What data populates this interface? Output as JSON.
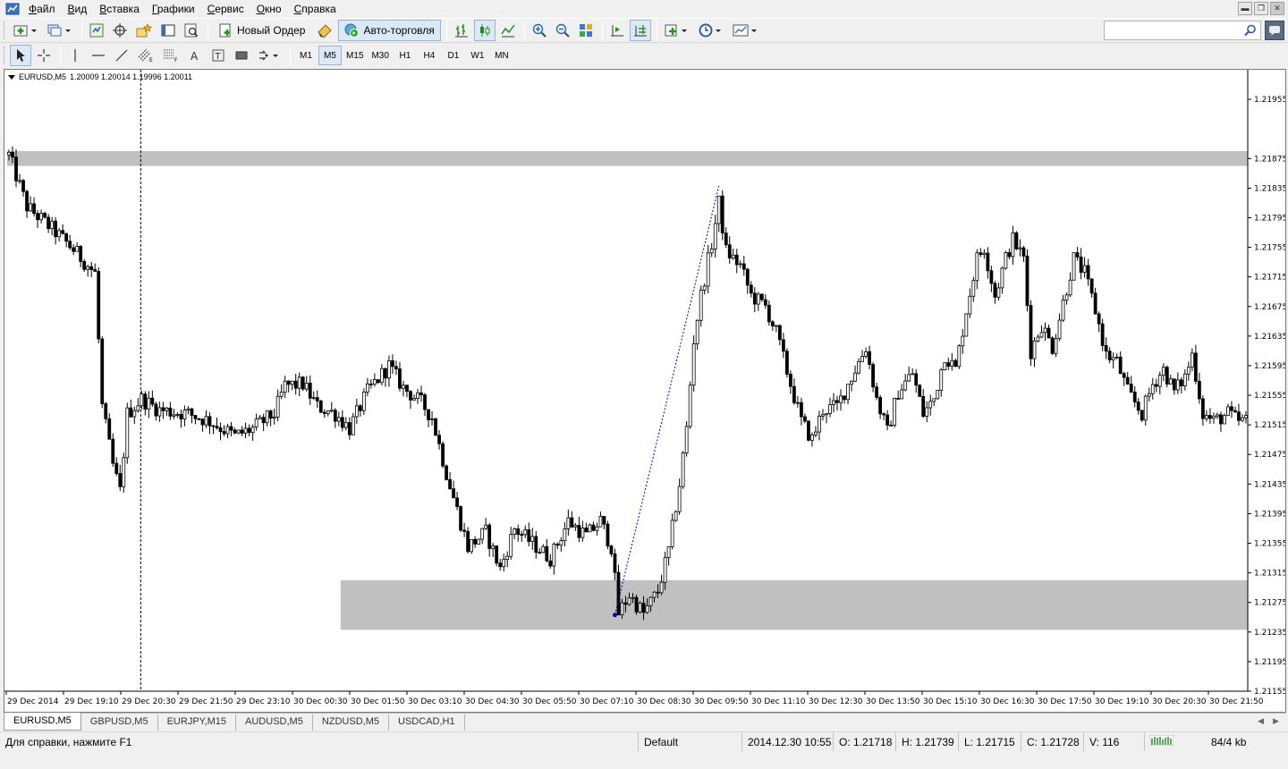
{
  "menu": {
    "items": [
      {
        "hot": "Ф",
        "rest": "айл"
      },
      {
        "hot": "В",
        "rest": "ид"
      },
      {
        "hot": "В",
        "rest": "ставка"
      },
      {
        "hot": "Г",
        "rest": "рафики"
      },
      {
        "hot": "С",
        "rest": "ервис"
      },
      {
        "hot": "О",
        "rest": "кно"
      },
      {
        "hot": "С",
        "rest": "правка"
      }
    ]
  },
  "toolbar": {
    "new_order_label": "Новый Ордер",
    "auto_trading_label": "Авто-торговля",
    "search_placeholder": ""
  },
  "timeframes": [
    "M1",
    "M5",
    "M15",
    "M30",
    "H1",
    "H4",
    "D1",
    "W1",
    "MN"
  ],
  "active_timeframe": "M5",
  "chart_header": {
    "symbol": "EURUSD,M5",
    "ohlc": "1.20009 1.20014 1.19996 1.20011"
  },
  "chart_data": {
    "type": "candlestick",
    "symbol": "EURUSD",
    "timeframe": "M5",
    "y_ticks": [
      "1.21955",
      "1.21875",
      "1.21835",
      "1.21795",
      "1.21755",
      "1.21715",
      "1.21675",
      "1.21635",
      "1.21595",
      "1.21555",
      "1.21515",
      "1.21475",
      "1.21435",
      "1.21395",
      "1.21355",
      "1.21315",
      "1.21275",
      "1.21235",
      "1.21195",
      "1.21155"
    ],
    "ylim": [
      1.21155,
      1.21995
    ],
    "x_ticks": [
      "29 Dec 2014",
      "29 Dec 19:10",
      "29 Dec 20:30",
      "29 Dec 21:50",
      "29 Dec 23:10",
      "30 Dec 00:30",
      "30 Dec 01:50",
      "30 Dec 03:10",
      "30 Dec 04:30",
      "30 Dec 05:50",
      "30 Dec 07:10",
      "30 Dec 08:30",
      "30 Dec 09:50",
      "30 Dec 11:10",
      "30 Dec 12:30",
      "30 Dec 13:50",
      "30 Dec 15:10",
      "30 Dec 16:30",
      "30 Dec 17:50",
      "30 Dec 19:10",
      "30 Dec 20:30",
      "30 Dec 21:50"
    ],
    "zones": [
      {
        "from": 1.21865,
        "to": 1.21885,
        "color": "#c0c0c0",
        "start_index": 0
      },
      {
        "from": 1.21238,
        "to": 1.21305,
        "color": "#c0c0c0",
        "start_index": 93
      }
    ],
    "period_separator_index": 37,
    "trend_line": {
      "from_index": 169,
      "from_price": 1.21258,
      "to_index": 198,
      "to_price": 1.21838,
      "color": "#0000cc"
    },
    "anchor": [
      {
        "x": 0,
        "y": 1.2188
      },
      {
        "x": 5,
        "y": 1.2181
      },
      {
        "x": 12,
        "y": 1.2178
      },
      {
        "x": 18,
        "y": 1.21752
      },
      {
        "x": 24,
        "y": 1.2172
      },
      {
        "x": 26,
        "y": 1.2154
      },
      {
        "x": 29,
        "y": 1.2146
      },
      {
        "x": 31,
        "y": 1.21425
      },
      {
        "x": 33,
        "y": 1.2153
      },
      {
        "x": 37,
        "y": 1.2155
      },
      {
        "x": 42,
        "y": 1.21535
      },
      {
        "x": 50,
        "y": 1.2153
      },
      {
        "x": 56,
        "y": 1.2152
      },
      {
        "x": 63,
        "y": 1.215
      },
      {
        "x": 68,
        "y": 1.2151
      },
      {
        "x": 74,
        "y": 1.2153
      },
      {
        "x": 77,
        "y": 1.21568
      },
      {
        "x": 82,
        "y": 1.2157
      },
      {
        "x": 86,
        "y": 1.2154
      },
      {
        "x": 91,
        "y": 1.2153
      },
      {
        "x": 95,
        "y": 1.2151
      },
      {
        "x": 100,
        "y": 1.2156
      },
      {
        "x": 106,
        "y": 1.21595
      },
      {
        "x": 110,
        "y": 1.21565
      },
      {
        "x": 115,
        "y": 1.21545
      },
      {
        "x": 118,
        "y": 1.21525
      },
      {
        "x": 122,
        "y": 1.2145
      },
      {
        "x": 125,
        "y": 1.214
      },
      {
        "x": 128,
        "y": 1.2135
      },
      {
        "x": 133,
        "y": 1.2137
      },
      {
        "x": 137,
        "y": 1.2132
      },
      {
        "x": 141,
        "y": 1.21375
      },
      {
        "x": 146,
        "y": 1.21355
      },
      {
        "x": 151,
        "y": 1.21335
      },
      {
        "x": 156,
        "y": 1.21385
      },
      {
        "x": 161,
        "y": 1.21365
      },
      {
        "x": 165,
        "y": 1.21385
      },
      {
        "x": 168,
        "y": 1.2135
      },
      {
        "x": 170,
        "y": 1.2126
      },
      {
        "x": 173,
        "y": 1.21285
      },
      {
        "x": 177,
        "y": 1.2126
      },
      {
        "x": 181,
        "y": 1.2129
      },
      {
        "x": 184,
        "y": 1.21345
      },
      {
        "x": 187,
        "y": 1.21435
      },
      {
        "x": 189,
        "y": 1.2151
      },
      {
        "x": 191,
        "y": 1.2163
      },
      {
        "x": 193,
        "y": 1.2169
      },
      {
        "x": 196,
        "y": 1.2176
      },
      {
        "x": 198,
        "y": 1.21815
      },
      {
        "x": 200,
        "y": 1.2175
      },
      {
        "x": 204,
        "y": 1.2173
      },
      {
        "x": 207,
        "y": 1.2169
      },
      {
        "x": 211,
        "y": 1.21675
      },
      {
        "x": 214,
        "y": 1.2164
      },
      {
        "x": 218,
        "y": 1.2157
      },
      {
        "x": 221,
        "y": 1.2152
      },
      {
        "x": 224,
        "y": 1.21495
      },
      {
        "x": 227,
        "y": 1.21535
      },
      {
        "x": 231,
        "y": 1.2154
      },
      {
        "x": 235,
        "y": 1.2158
      },
      {
        "x": 239,
        "y": 1.2162
      },
      {
        "x": 242,
        "y": 1.2155
      },
      {
        "x": 245,
        "y": 1.21505
      },
      {
        "x": 248,
        "y": 1.2156
      },
      {
        "x": 252,
        "y": 1.21585
      },
      {
        "x": 255,
        "y": 1.2153
      },
      {
        "x": 258,
        "y": 1.2155
      },
      {
        "x": 261,
        "y": 1.2161
      },
      {
        "x": 264,
        "y": 1.2159
      },
      {
        "x": 267,
        "y": 1.2167
      },
      {
        "x": 270,
        "y": 1.2174
      },
      {
        "x": 272,
        "y": 1.21755
      },
      {
        "x": 275,
        "y": 1.2169
      },
      {
        "x": 278,
        "y": 1.2174
      },
      {
        "x": 280,
        "y": 1.21765
      },
      {
        "x": 283,
        "y": 1.2174
      },
      {
        "x": 285,
        "y": 1.21615
      },
      {
        "x": 288,
        "y": 1.2165
      },
      {
        "x": 291,
        "y": 1.2162
      },
      {
        "x": 294,
        "y": 1.2168
      },
      {
        "x": 297,
        "y": 1.2174
      },
      {
        "x": 300,
        "y": 1.2172
      },
      {
        "x": 303,
        "y": 1.2167
      },
      {
        "x": 306,
        "y": 1.2161
      },
      {
        "x": 309,
        "y": 1.216
      },
      {
        "x": 312,
        "y": 1.2156
      },
      {
        "x": 316,
        "y": 1.2153
      },
      {
        "x": 319,
        "y": 1.2157
      },
      {
        "x": 322,
        "y": 1.2159
      },
      {
        "x": 325,
        "y": 1.2156
      },
      {
        "x": 328,
        "y": 1.2158
      },
      {
        "x": 330,
        "y": 1.2161
      },
      {
        "x": 333,
        "y": 1.2153
      },
      {
        "x": 336,
        "y": 1.2152
      },
      {
        "x": 340,
        "y": 1.2153
      },
      {
        "x": 343,
        "y": 1.2152
      },
      {
        "x": 345,
        "y": 1.2152
      }
    ]
  },
  "chart_tabs": [
    "EURUSD,M5",
    "GBPUSD,M5",
    "EURJPY,M15",
    "AUDUSD,M5",
    "NZDUSD,M5",
    "USDCAD,H1"
  ],
  "active_tab": "EURUSD,M5",
  "status": {
    "help": "Для справки, нажмите F1",
    "profile": "Default",
    "datetime": "2014.12.30 10:55",
    "open": "O: 1.21718",
    "high": "H: 1.21739",
    "low": "L: 1.21715",
    "close": "C: 1.21728",
    "volume": "V: 116",
    "traffic": "84/4 kb"
  },
  "colors": {
    "zone": "#c0c0c0",
    "trendline": "#0000cc",
    "candle": "#000000",
    "background": "#ffffff"
  }
}
